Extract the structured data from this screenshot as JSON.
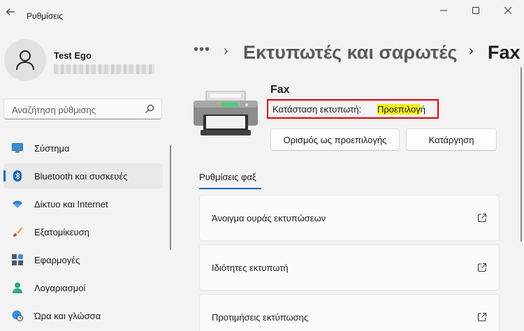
{
  "window": {
    "title": "Ρυθμίσεις"
  },
  "profile": {
    "name": "Test Ego"
  },
  "search": {
    "placeholder": "Αναζήτηση ρύθμισης"
  },
  "nav": {
    "items": [
      {
        "label": "Σύστημα",
        "icon": "system-icon"
      },
      {
        "label": "Bluetooth και συσκευές",
        "icon": "bluetooth-icon",
        "active": true
      },
      {
        "label": "Δίκτυο και Internet",
        "icon": "wifi-icon"
      },
      {
        "label": "Εξατομίκευση",
        "icon": "brush-icon"
      },
      {
        "label": "Εφαρμογές",
        "icon": "apps-icon"
      },
      {
        "label": "Λογαριασμοί",
        "icon": "person-icon"
      },
      {
        "label": "Ώρα και γλώσσα",
        "icon": "globe-clock-icon"
      }
    ]
  },
  "breadcrumb": {
    "more": "•••",
    "parent": "Εκτυπωτές και σαρωτές",
    "current": "Fax"
  },
  "printer": {
    "name": "Fax",
    "status_label": "Κατάσταση εκτυπωτή:",
    "status_value_highlighted": "Προεπιλογ",
    "status_value_rest": "ή",
    "set_default_label": "Ορισμός ως προεπιλογής",
    "remove_label": "Κατάργηση"
  },
  "tab": {
    "label": "Ρυθμίσεις φαξ"
  },
  "cards": [
    {
      "label": "Άνοιγμα ουράς εκτυπώσεων"
    },
    {
      "label": "Ιδιότητες εκτυπωτή"
    },
    {
      "label": "Προτιμήσεις εκτύπωσης"
    }
  ],
  "colors": {
    "accent": "#0067c0",
    "highlight": "#f2f21a",
    "annotation_border": "#e00000"
  }
}
